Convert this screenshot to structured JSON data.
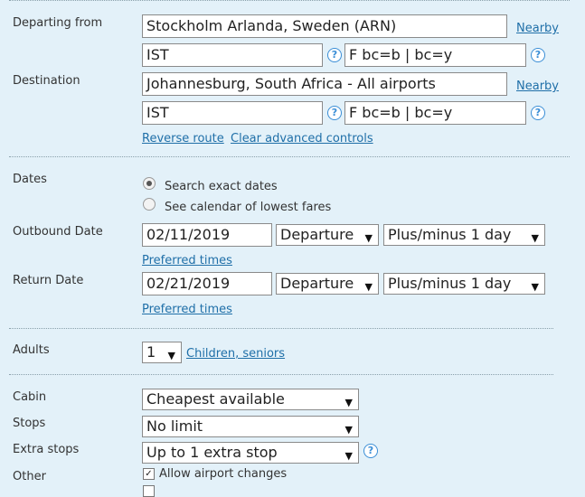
{
  "route": {
    "departing_label": "Departing from",
    "departing_value": "Stockholm Arlanda, Sweden (ARN)",
    "departing_code": "IST",
    "departing_fare": "F bc=b | bc=y",
    "destination_label": "Destination",
    "destination_value": "Johannesburg, South Africa - All airports",
    "destination_code": "IST",
    "destination_fare": "F bc=b | bc=y",
    "nearby": "Nearby",
    "help": "?",
    "reverse_route": "Reverse route",
    "clear_advanced": "Clear advanced controls"
  },
  "dates": {
    "label": "Dates",
    "option_exact": "Search exact dates",
    "option_calendar": "See calendar of lowest fares",
    "selected": "exact",
    "outbound_label": "Outbound Date",
    "outbound_value": "02/11/2019",
    "return_label": "Return Date",
    "return_value": "02/21/2019",
    "time_type": "Departure",
    "flex": "Plus/minus 1 day",
    "preferred_times": "Preferred times"
  },
  "passengers": {
    "adults_label": "Adults",
    "adults_value": "1",
    "children_link": "Children, seniors"
  },
  "options": {
    "cabin_label": "Cabin",
    "cabin_value": "Cheapest available",
    "stops_label": "Stops",
    "stops_value": "No limit",
    "extra_stops_label": "Extra stops",
    "extra_stops_value": "Up to 1 extra stop",
    "other_label": "Other",
    "allow_airport_changes": "Allow airport changes",
    "allow_airport_changes_checked": true
  },
  "icons": {
    "dropdown": "▼",
    "check": "✓"
  },
  "colors": {
    "background": "#e3f1f9",
    "link": "#1f6fa8",
    "help_icon": "#3a8ed6"
  }
}
